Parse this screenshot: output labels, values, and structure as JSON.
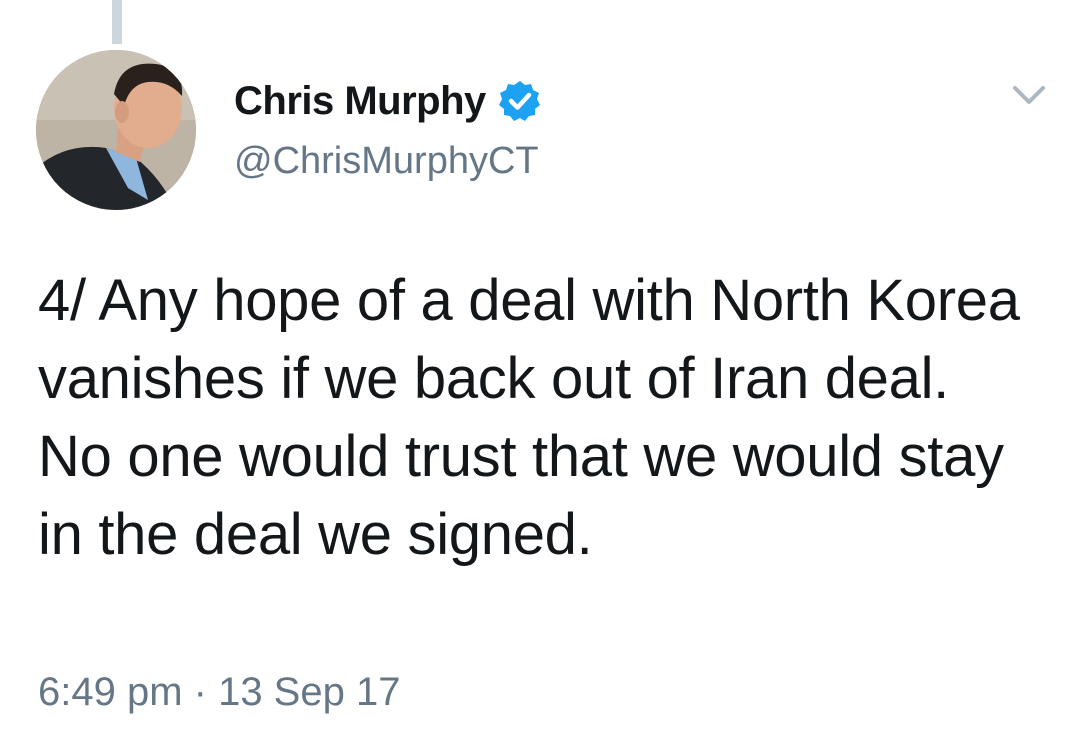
{
  "tweet": {
    "author": {
      "display_name": "Chris Murphy",
      "handle": "@ChrisMurphyCT",
      "verified": true,
      "avatar_icon": "profile-photo"
    },
    "text": "4/ Any hope of a deal with North Korea vanishes if we back out of Iran deal.  No one would trust that we would stay in the deal we signed.",
    "timestamp": "6:49 pm · 13 Sep 17"
  },
  "colors": {
    "text": "#14171a",
    "secondary_text": "#657786",
    "verified_blue": "#1da1f2",
    "thread_line": "#ccd6dd",
    "background": "#ffffff"
  }
}
